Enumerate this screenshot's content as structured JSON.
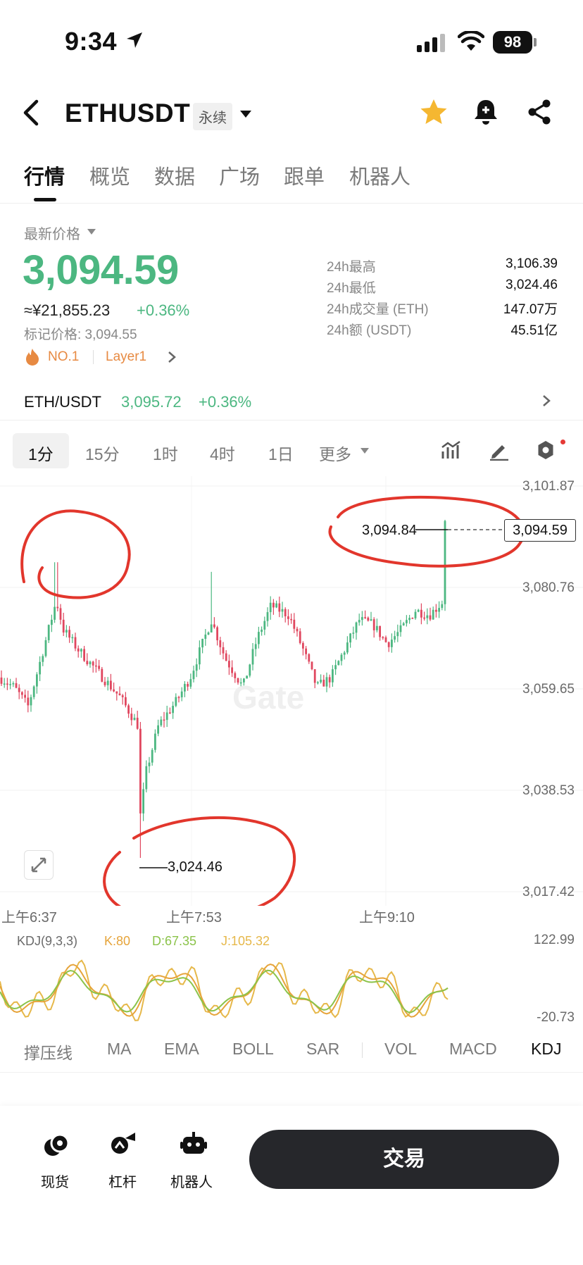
{
  "status_bar": {
    "time": "9:34",
    "battery": "98"
  },
  "header": {
    "symbol": "ETHUSDT",
    "contract_type": "永续"
  },
  "tabs": [
    {
      "label": "行情",
      "active": true
    },
    {
      "label": "概览"
    },
    {
      "label": "数据"
    },
    {
      "label": "广场"
    },
    {
      "label": "跟单"
    },
    {
      "label": "机器人"
    }
  ],
  "price": {
    "label": "最新价格",
    "last": "3,094.59",
    "cny": "≈¥21,855.23",
    "change": "+0.36%",
    "mark": "标记价格: 3,094.55",
    "rank": "NO.1",
    "category": "Layer1"
  },
  "stats": [
    {
      "label": "24h最高",
      "value": "3,106.39"
    },
    {
      "label": "24h最低",
      "value": "3,024.46"
    },
    {
      "label": "24h成交量 (ETH)",
      "value": "147.07万"
    },
    {
      "label": "24h额 (USDT)",
      "value": "45.51亿"
    }
  ],
  "pair": {
    "label": "ETH/USDT",
    "price": "3,095.72",
    "change": "+0.36%"
  },
  "timeframes": [
    {
      "label": "1分",
      "active": true
    },
    {
      "label": "15分"
    },
    {
      "label": "1时"
    },
    {
      "label": "4时"
    },
    {
      "label": "1日"
    },
    {
      "label": "更多"
    }
  ],
  "chart_data": {
    "type": "candlestick",
    "y_ticks": [
      "3,101.87",
      "3,080.76",
      "3,059.65",
      "3,038.53",
      "3,017.42"
    ],
    "ylim": [
      3017.42,
      3101.87
    ],
    "x_ticks": [
      "上午6:37",
      "上午7:53",
      "上午9:10"
    ],
    "high_marker": "3,094.84",
    "low_marker": "3,024.46",
    "last_price_tag": "3,094.59",
    "watermark": "Gate",
    "colors": {
      "up": "#4cb781",
      "down": "#e0475f"
    }
  },
  "kdj": {
    "title": "KDJ(9,3,3)",
    "k": "K:80",
    "d": "D:67.35",
    "j": "J:105.32",
    "max": "122.99",
    "min": "-20.73"
  },
  "indicators": [
    {
      "label": "撑压线"
    },
    {
      "label": "MA"
    },
    {
      "label": "EMA"
    },
    {
      "label": "BOLL"
    },
    {
      "label": "SAR"
    },
    {
      "label": "VOL"
    },
    {
      "label": "MACD"
    },
    {
      "label": "KDJ",
      "active": true
    }
  ],
  "bottom_nav": [
    {
      "label": "现货"
    },
    {
      "label": "杠杆"
    },
    {
      "label": "机器人"
    }
  ],
  "trade_button": "交易"
}
